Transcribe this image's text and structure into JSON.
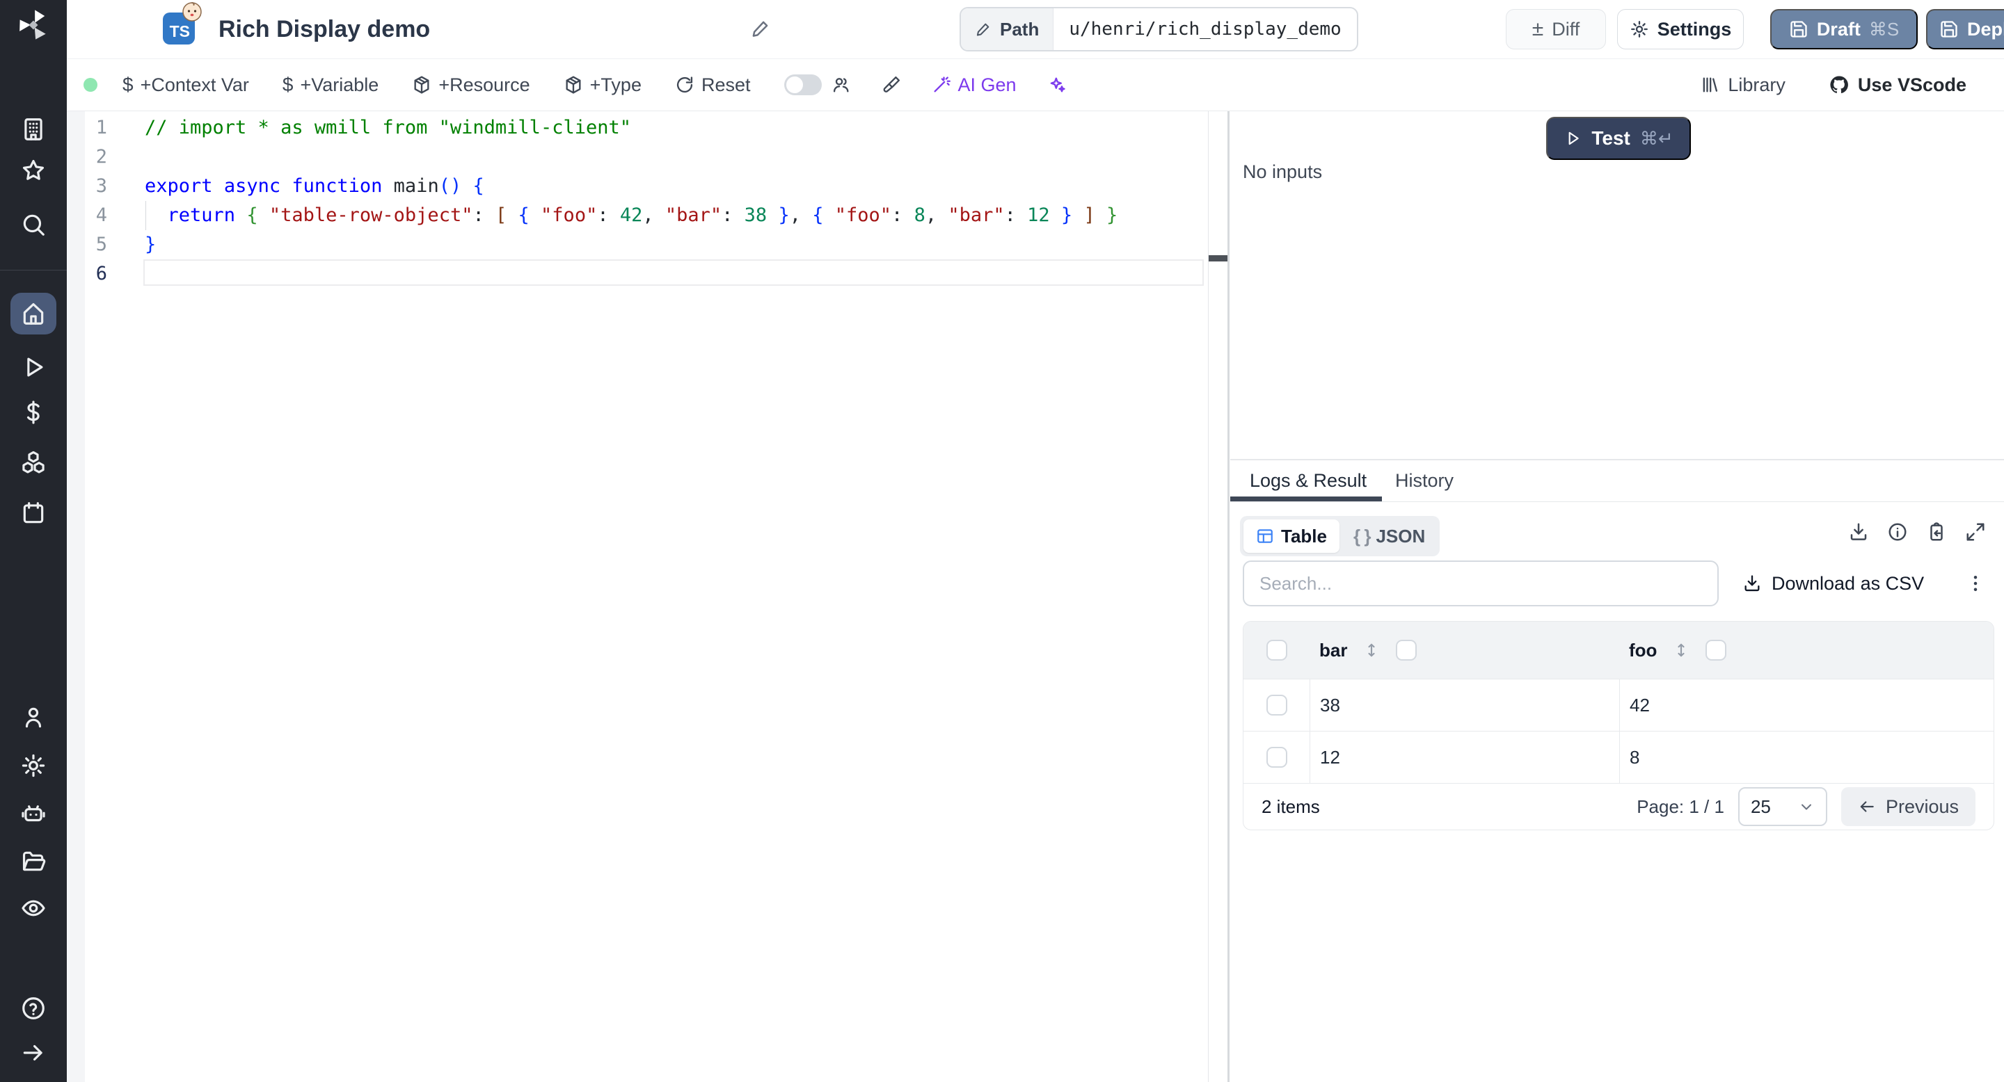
{
  "header": {
    "title": "Rich Display demo",
    "lang_badge": "TS",
    "path_label": "Path",
    "path_value": "u/henri/rich_display_demo",
    "diff_label": "Diff",
    "plus_minus": "±",
    "settings_label": "Settings",
    "draft_label": "Draft",
    "draft_shortcut": "⌘S",
    "deploy_label": "Deploy",
    "button_color": "#6c84a4"
  },
  "toolbar": {
    "context_var": "+Context Var",
    "variable": "+Variable",
    "resource": "+Resource",
    "type": "+Type",
    "reset": "Reset",
    "ai_gen": "AI Gen",
    "library": "Library",
    "use_vscode": "Use VScode",
    "dollar": "$",
    "status_dot_color": "#8fe7b1",
    "ai_accent_color": "#7c3aed"
  },
  "sidebar": {
    "items": [
      "workspace",
      "favorites",
      "search",
      "home",
      "runs",
      "variables",
      "resources",
      "schedules",
      "users",
      "settings",
      "workers",
      "folders",
      "audit-logs",
      "help",
      "expand"
    ],
    "active_item": "home"
  },
  "editor": {
    "lines": [
      {
        "n": "1",
        "tokens": [
          [
            "comment",
            "// import * as wmill from \"windmill-client\""
          ]
        ]
      },
      {
        "n": "2",
        "tokens": []
      },
      {
        "n": "3",
        "tokens": [
          [
            "kw",
            "export"
          ],
          [
            "plain",
            " "
          ],
          [
            "kw",
            "async"
          ],
          [
            "plain",
            " "
          ],
          [
            "kw",
            "function"
          ],
          [
            "plain",
            " "
          ],
          [
            "fn",
            "main"
          ],
          [
            "b1",
            "()"
          ],
          [
            "plain",
            " "
          ],
          [
            "b1",
            "{"
          ]
        ]
      },
      {
        "n": "4",
        "tokens": [
          [
            "plain",
            "  "
          ],
          [
            "kw",
            "return"
          ],
          [
            "plain",
            " "
          ],
          [
            "b2",
            "{"
          ],
          [
            "plain",
            " "
          ],
          [
            "str",
            "\"table-row-object\""
          ],
          [
            "plain",
            ": "
          ],
          [
            "b3",
            "["
          ],
          [
            "plain",
            " "
          ],
          [
            "b1",
            "{"
          ],
          [
            "plain",
            " "
          ],
          [
            "str",
            "\"foo\""
          ],
          [
            "plain",
            ": "
          ],
          [
            "num",
            "42"
          ],
          [
            "plain",
            ", "
          ],
          [
            "str",
            "\"bar\""
          ],
          [
            "plain",
            ": "
          ],
          [
            "num",
            "38"
          ],
          [
            "plain",
            " "
          ],
          [
            "b1",
            "}"
          ],
          [
            "plain",
            ", "
          ],
          [
            "b1",
            "{"
          ],
          [
            "plain",
            " "
          ],
          [
            "str",
            "\"foo\""
          ],
          [
            "plain",
            ": "
          ],
          [
            "num",
            "8"
          ],
          [
            "plain",
            ", "
          ],
          [
            "str",
            "\"bar\""
          ],
          [
            "plain",
            ": "
          ],
          [
            "num",
            "12"
          ],
          [
            "plain",
            " "
          ],
          [
            "b1",
            "}"
          ],
          [
            "plain",
            " "
          ],
          [
            "b3",
            "]"
          ],
          [
            "plain",
            " "
          ],
          [
            "b2",
            "}"
          ]
        ]
      },
      {
        "n": "5",
        "tokens": [
          [
            "b1",
            "}"
          ]
        ]
      },
      {
        "n": "6",
        "tokens": [],
        "active": true
      }
    ]
  },
  "run": {
    "test_label": "Test",
    "test_shortcut": "⌘↵",
    "no_inputs": "No inputs",
    "test_button_color": "#36425e"
  },
  "result": {
    "tabs": [
      {
        "label": "Logs & Result",
        "active": true
      },
      {
        "label": "History",
        "active": false
      }
    ],
    "view_table_label": "Table",
    "view_json_label": "JSON",
    "json_braces": "{ }",
    "search_placeholder": "Search...",
    "download_csv_label": "Download as CSV",
    "table": {
      "columns": [
        "bar",
        "foo"
      ],
      "rows": [
        [
          "38",
          "42"
        ],
        [
          "12",
          "8"
        ]
      ]
    },
    "footer": {
      "items_count": "2 items",
      "page_indicator": "Page: 1 / 1",
      "page_size": "25",
      "previous_label": "Previous"
    }
  }
}
